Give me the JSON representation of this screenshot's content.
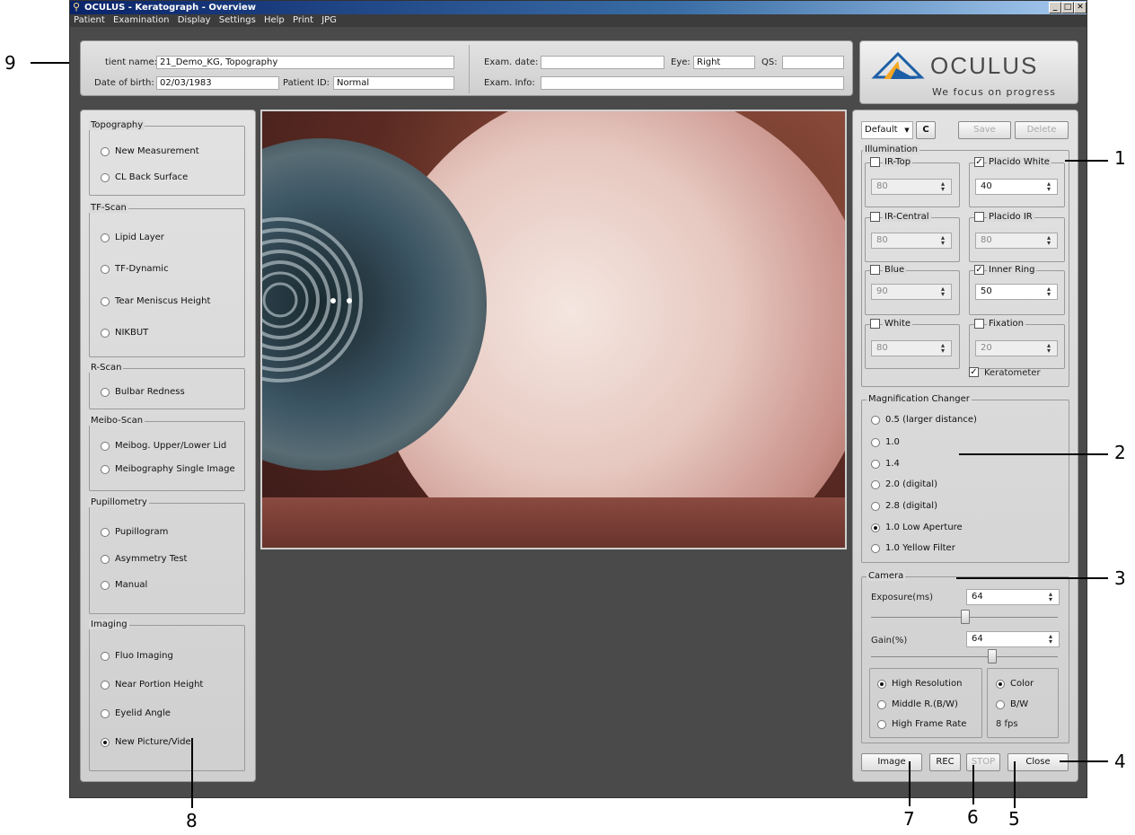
{
  "window": {
    "title": "OCULUS - Keratograph - Overview"
  },
  "menu": [
    "Patient",
    "Examination",
    "Display",
    "Settings",
    "Help",
    "Print",
    "JPG"
  ],
  "patient": {
    "name_label": "tient name:",
    "name_value": "21_Demo_KG, Topography",
    "dob_label": "Date of birth:",
    "dob_value": "02/03/1983",
    "id_label": "Patient ID:",
    "id_value": "Normal",
    "exam_date_label": "Exam. date:",
    "exam_date_value": "",
    "eye_label": "Eye:",
    "eye_value": "Right",
    "qs_label": "QS:",
    "qs_value": "",
    "exam_info_label": "Exam. Info:",
    "exam_info_value": ""
  },
  "brand": {
    "name": "OCULUS",
    "tagline": "We focus on progress"
  },
  "left_panel": {
    "topography": {
      "title": "Topography",
      "items": [
        "New Measurement",
        "CL Back Surface"
      ]
    },
    "tfscan": {
      "title": "TF-Scan",
      "items": [
        "Lipid Layer",
        "TF-Dynamic",
        "Tear Meniscus Height",
        "NIKBUT"
      ]
    },
    "rscan": {
      "title": "R-Scan",
      "items": [
        "Bulbar Redness"
      ]
    },
    "meibo": {
      "title": "Meibo-Scan",
      "items": [
        "Meibog. Upper/Lower Lid",
        "Meibography Single Image"
      ]
    },
    "pupil": {
      "title": "Pupillometry",
      "items": [
        "Pupillogram",
        "Asymmetry Test",
        "Manual"
      ]
    },
    "imaging": {
      "title": "Imaging",
      "items": [
        "Fluo Imaging",
        "Near Portion Height",
        "Eyelid Angle",
        "New Picture/Vide"
      ],
      "selected": 3
    }
  },
  "right_panel": {
    "preset": "Default",
    "refresh_label": "C",
    "save_label": "Save",
    "delete_label": "Delete",
    "illumination": {
      "title": "Illumination",
      "ir_top": {
        "label": "IR-Top",
        "value": "80",
        "checked": false
      },
      "placido_white": {
        "label": "Placido White",
        "value": "40",
        "checked": true
      },
      "ir_central": {
        "label": "IR-Central",
        "value": "80",
        "checked": false
      },
      "placido_ir": {
        "label": "Placido IR",
        "value": "80",
        "checked": false
      },
      "blue": {
        "label": "Blue",
        "value": "90",
        "checked": false
      },
      "inner_ring": {
        "label": "Inner Ring",
        "value": "50",
        "checked": true
      },
      "white": {
        "label": "White",
        "value": "80",
        "checked": false
      },
      "fixation": {
        "label": "Fixation",
        "value": "20",
        "checked": false
      },
      "keratometer": {
        "label": "Keratometer",
        "checked": true
      }
    },
    "magnification": {
      "title": "Magnification Changer",
      "options": [
        "0.5 (larger distance)",
        "1.0",
        "1.4",
        "2.0 (digital)",
        "2.8 (digital)",
        "1.0 Low Aperture",
        "1.0 Yellow Filter"
      ],
      "selected": 5
    },
    "camera": {
      "title": "Camera",
      "exposure_label": "Exposure(ms)",
      "exposure_value": "64",
      "gain_label": "Gain(%)",
      "gain_value": "64",
      "resolution_options": [
        "High Resolution",
        "Middle R.(B/W)",
        "High Frame Rate"
      ],
      "resolution_selected": 0,
      "color_options": [
        "Color",
        "B/W"
      ],
      "color_selected": 0,
      "fps": "8 fps"
    },
    "buttons": {
      "image": "Image",
      "rec": "REC",
      "stop": "STOP",
      "close": "Close"
    }
  },
  "callouts": [
    "1",
    "2",
    "3",
    "4",
    "5",
    "6",
    "7",
    "8",
    "9"
  ]
}
